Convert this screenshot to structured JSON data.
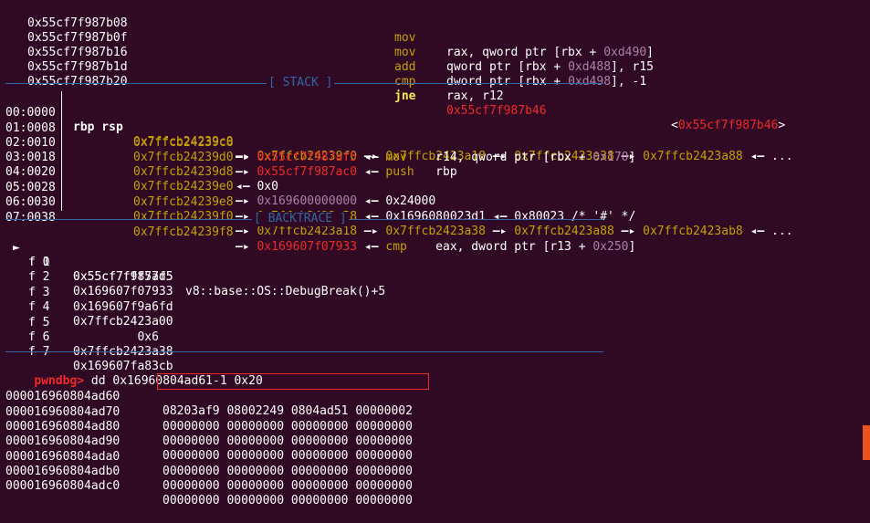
{
  "disasm": [
    {
      "addr": "0x55cf7f987b08",
      "mnemonic": "mov",
      "op1": "rax, qword ptr [rbx + ",
      "num": "0xd490",
      "op2": "]"
    },
    {
      "addr": "0x55cf7f987b0f",
      "mnemonic": "mov",
      "op1": "qword ptr [rbx + ",
      "num": "0xd488",
      "op2": "], r15"
    },
    {
      "addr": "0x55cf7f987b16",
      "mnemonic": "add",
      "op1": "dword ptr [rbx + ",
      "num": "0xd498",
      "op2": "], -1"
    },
    {
      "addr": "0x55cf7f987b1d",
      "mnemonic": "cmp",
      "op1": "rax, r12",
      "num": "",
      "op2": ""
    },
    {
      "addr": "0x55cf7f987b20",
      "mnemonic": "jne",
      "target": "0x55cf7f987b46",
      "target_label_open": "<",
      "target_label": "0x55cf7f987b46",
      "target_label_close": ">"
    }
  ],
  "stack_header": "[ STACK ]",
  "stack": [
    {
      "idx": "00:0000",
      "regs": "rbp rsp",
      "addr": "0x7ffcb24239c0"
    },
    {
      "idx": "01:0008",
      "regs": "",
      "addr": "0x7ffcb24239c8"
    },
    {
      "idx": "02:0010",
      "regs": "",
      "addr": "0x7ffcb24239d0"
    },
    {
      "idx": "03:0018",
      "regs": "",
      "addr": "0x7ffcb24239d8"
    },
    {
      "idx": "04:0020",
      "regs": "",
      "addr": "0x7ffcb24239e0"
    },
    {
      "idx": "05:0028",
      "regs": "",
      "addr": "0x7ffcb24239e8"
    },
    {
      "idx": "06:0030",
      "regs": "",
      "addr": "0x7ffcb24239f0"
    },
    {
      "idx": "07:0038",
      "regs": "",
      "addr": "0x7ffcb24239f8"
    }
  ],
  "stack_chain": {
    "r0": [
      "0x7ffcb24239f0",
      "0x7ffcb2423a18",
      "0x7ffcb2423a38",
      "0x7ffcb2423a88",
      "..."
    ],
    "r1": {
      "ptr": "0x55cf7f987af5",
      "mn": "mov",
      "ops_a": "r14, qword ptr [rbx + ",
      "num": "0x170",
      "ops_b": "]"
    },
    "r2": {
      "ptr": "0x55cf7f987ac0",
      "mn": "push",
      "ops_a": "rbp"
    },
    "r3": {
      "val": "0x0"
    },
    "r4": {
      "ptr": "0x169600000000",
      "val": "0x24000"
    },
    "r5": {
      "ptr": "0x7ffcb2423a58",
      "val": "0x1696080023d1",
      "val2": "0x80023",
      "comment": "/* '#' */"
    },
    "r6": [
      "0x7ffcb2423a18",
      "0x7ffcb2423a38",
      "0x7ffcb2423a88",
      "0x7ffcb2423ab8",
      "..."
    ],
    "r7": {
      "ptr": "0x169607f07933",
      "mn": "cmp",
      "ops_a": "eax, dword ptr [r13 + ",
      "num": "0x250",
      "ops_b": "]"
    }
  },
  "arrow_right": "—▸",
  "arrow_left": "◂—",
  "backtrace_header": "[ BACKTRACE ]",
  "backtrace": [
    {
      "marker": "►",
      "frame": "f 0",
      "addr": "0x55cf7fff57d5",
      "sym": "v8::base::OS::DebugBreak()+5"
    },
    {
      "marker": "",
      "frame": "f 1",
      "addr": "0x55cf7f987af5",
      "sym": ""
    },
    {
      "marker": "",
      "frame": "f 2",
      "addr": "0x169607f07933",
      "sym": ""
    },
    {
      "marker": "",
      "frame": "f 3",
      "addr": "0x169607f9a6fd",
      "sym": ""
    },
    {
      "marker": "",
      "frame": "f 4",
      "addr": "0x7ffcb2423a00",
      "sym": ""
    },
    {
      "marker": "",
      "frame": "f 5",
      "addr": "         0x6",
      "sym": ""
    },
    {
      "marker": "",
      "frame": "f 6",
      "addr": "0x7ffcb2423a38",
      "sym": ""
    },
    {
      "marker": "",
      "frame": "f 7",
      "addr": "0x169607fa83cb",
      "sym": ""
    }
  ],
  "prompt": "pwndbg>",
  "command": " dd 0x16960804ad61-1 0x20",
  "dump": [
    {
      "addr": "000016960804ad60",
      "words": "08203af9 08002249 0804ad51 00000002"
    },
    {
      "addr": "000016960804ad70",
      "words": "00000000 00000000 00000000 00000000"
    },
    {
      "addr": "000016960804ad80",
      "words": "00000000 00000000 00000000 00000000"
    },
    {
      "addr": "000016960804ad90",
      "words": "00000000 00000000 00000000 00000000"
    },
    {
      "addr": "000016960804ada0",
      "words": "00000000 00000000 00000000 00000000"
    },
    {
      "addr": "000016960804adb0",
      "words": "00000000 00000000 00000000 00000000"
    },
    {
      "addr": "000016960804adc0",
      "words": "00000000 00000000 00000000 00000000"
    }
  ],
  "colors": {
    "background": "#300a24",
    "separator": "#3465a4",
    "stack_addr": "#c4a000",
    "code_addr": "#ef2929",
    "heap_addr": "#ad7fa8",
    "prompt": "#ef2929",
    "highlight_box": "#ef2929"
  }
}
